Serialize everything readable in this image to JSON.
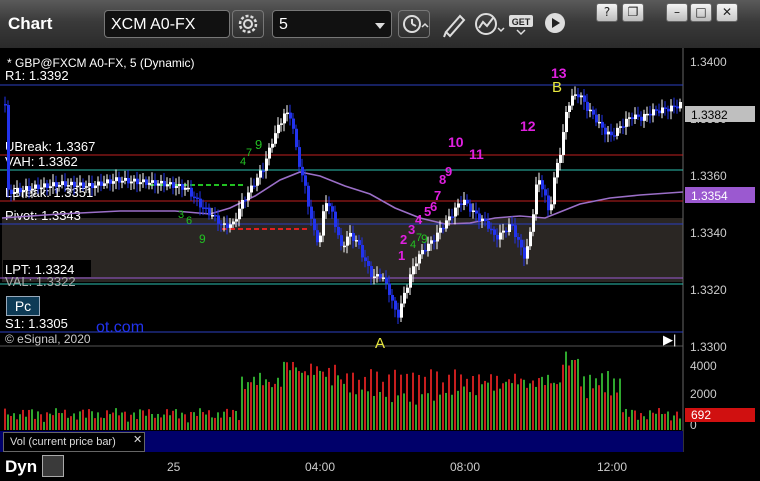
{
  "window": {
    "title": "Chart",
    "symbol": "XCM A0-FX",
    "interval": "5",
    "controls": {
      "help": "?",
      "restore": "❐",
      "minimize": "–",
      "maximize": "□",
      "close": "✕"
    },
    "toolbar_icons": [
      "gear-icon",
      "clock-icon",
      "pencil-icon",
      "line-study-icon",
      "get-icon",
      "play-icon"
    ]
  },
  "chart": {
    "series_label": "* GBP@FXCM A0-FX, 5 (Dynamic)",
    "copyright": "© eSignal, 2020",
    "watermark": "ot.com",
    "pc_button": "Pc",
    "levels": [
      {
        "name": "R1",
        "label": "R1: 1.3392",
        "color": "#2b3fbf"
      },
      {
        "name": "UBreak",
        "label": "UBreak: 1.3367",
        "color": "#c02020"
      },
      {
        "name": "VAH",
        "label": "VAH: 1.3362",
        "color": "#2bc0b0"
      },
      {
        "name": "LBreak",
        "label": "LBreak: 1.3351",
        "color": "#c02020"
      },
      {
        "name": "Pivot",
        "label": "Pivot: 1.3343",
        "color": "#2b3fbf"
      },
      {
        "name": "LPT",
        "label": "LPT: 1.3324",
        "color": "#9b59d0"
      },
      {
        "name": "VAL",
        "label": "VAL: 1.3322",
        "color": "#2bc0b0"
      },
      {
        "name": "S1",
        "label": "S1: 1.3305",
        "color": "#2b3fbf"
      }
    ],
    "price_axis": [
      "1.3400",
      "1.3380",
      "1.3360",
      "1.3340",
      "1.3320",
      "1.3300"
    ],
    "price_tags": [
      {
        "value": "1.3382",
        "bg": "#bfbfbf",
        "fg": "#000"
      },
      {
        "value": "1.3354",
        "bg": "#9b59d0",
        "fg": "#fff"
      }
    ],
    "markers": {
      "A": "A",
      "B": "B",
      "magenta_counts": [
        "1",
        "2",
        "3",
        "4",
        "5",
        "6",
        "7",
        "8",
        "9",
        "10",
        "11",
        "12",
        "13"
      ],
      "green_counts": [
        "1",
        "2",
        "3",
        "4",
        "5",
        "6",
        "7",
        "8",
        "9"
      ]
    },
    "colors": {
      "up": "#ffffff",
      "down": "#2233ee",
      "vwap": "#9b6fc8",
      "magenta": "#e020e0",
      "green": "#22c022",
      "yellow": "#e8e840"
    }
  },
  "volume": {
    "header": "Vol (current price bar)",
    "close": "✕",
    "axis": [
      "4000",
      "2000",
      "0"
    ],
    "current": "692",
    "current_bg": "#d01010"
  },
  "time_axis": [
    "25",
    "04:00",
    "08:00",
    "12:00"
  ],
  "bottom": {
    "label": "Dyn"
  }
}
